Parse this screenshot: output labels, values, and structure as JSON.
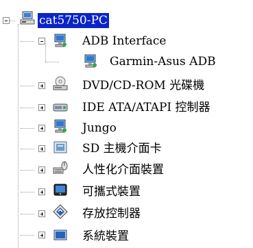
{
  "tree": {
    "root": {
      "label": "cat5750-PC",
      "icon": "computer-icon",
      "expanded": true,
      "selected": true
    },
    "nodes": [
      {
        "label": "ADB Interface",
        "icon": "device-monitor-icon",
        "expanded": true
      },
      {
        "label": "Garmin-Asus ADB",
        "icon": "device-monitor-icon",
        "child": true
      },
      {
        "label": "DVD/CD-ROM 光碟機",
        "icon": "optical-drive-icon",
        "expanded": false
      },
      {
        "label": "IDE ATA/ATAPI 控制器",
        "icon": "ide-controller-icon",
        "expanded": false
      },
      {
        "label": "Jungo",
        "icon": "device-monitor-icon",
        "expanded": false
      },
      {
        "label": "SD 主機介面卡",
        "icon": "sd-host-icon",
        "expanded": false
      },
      {
        "label": "人性化介面裝置",
        "icon": "hid-icon",
        "expanded": false
      },
      {
        "label": "可攜式裝置",
        "icon": "portable-device-icon",
        "expanded": false
      },
      {
        "label": "存放控制器",
        "icon": "storage-controller-icon",
        "expanded": false
      },
      {
        "label": "系統裝置",
        "icon": "system-devices-icon",
        "expanded": false
      }
    ]
  },
  "colors": {
    "selection_bg": "#0a24c8",
    "selection_fg": "#ffffff",
    "tree_lines": "#9a9a9a"
  }
}
